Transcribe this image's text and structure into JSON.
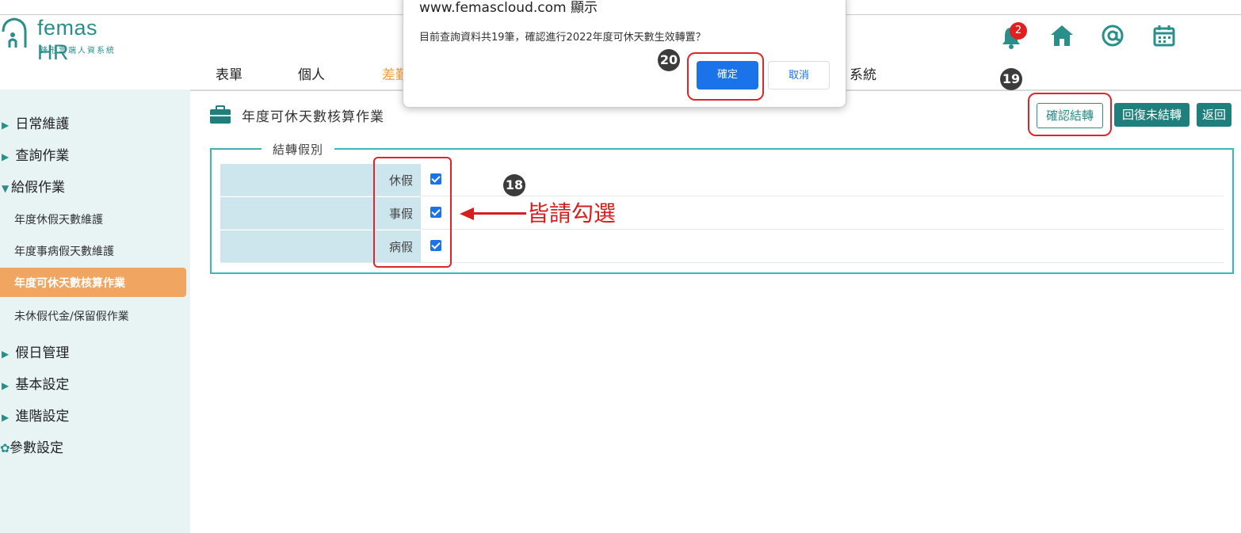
{
  "logo": {
    "title": "femas HR",
    "subtitle": "鋒形雲端人資系統"
  },
  "nav": {
    "items": [
      "表單",
      "個人",
      "差勤",
      "系統"
    ],
    "active_index": 2
  },
  "notifications": {
    "count": "2"
  },
  "sidebar": {
    "groups": [
      "日常維護",
      "查詢作業",
      "給假作業"
    ],
    "sub_items": [
      "年度休假天數維護",
      "年度事病假天數維護",
      "年度可休天數核算作業",
      "未休假代金/保留假作業"
    ],
    "more_groups": [
      "假日管理",
      "基本設定",
      "進階設定",
      "參數設定"
    ]
  },
  "page": {
    "title": "年度可休天數核算作業"
  },
  "buttons": {
    "confirm_transfer": "確認結轉",
    "revert": "回復未結轉",
    "back": "返回"
  },
  "leave_types": {
    "legend": "結轉假別",
    "rows": [
      {
        "label": "休假",
        "checked": true
      },
      {
        "label": "事假",
        "checked": true
      },
      {
        "label": "病假",
        "checked": true
      }
    ]
  },
  "annotations": {
    "step18": "18",
    "step19": "19",
    "step20": "20",
    "note": "皆請勾選"
  },
  "dialog": {
    "title": "www.femascloud.com 顯示",
    "message": "目前查詢資料共19筆，確認進行2022年度可休天數生效轉置？",
    "ok": "確定",
    "cancel": "取消"
  },
  "colors": {
    "teal": "#1f7f7d",
    "accent": "#f0a040",
    "sidebar_bg": "#e8f4f4",
    "annotation_red": "#e0242c"
  }
}
